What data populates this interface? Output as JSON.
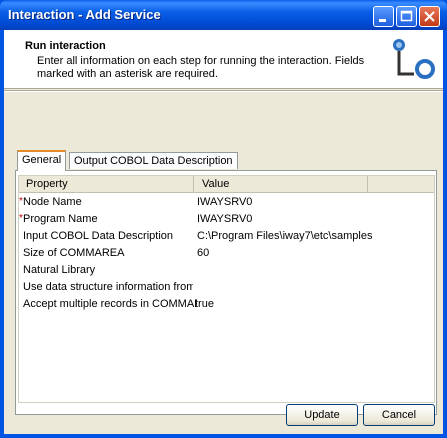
{
  "window": {
    "title": "Interaction - Add Service"
  },
  "header": {
    "title": "Run interaction",
    "description": "Enter all information on each step for running the interaction. Fields marked with an asterisk are required."
  },
  "tabs": [
    {
      "label": "General",
      "active": true
    },
    {
      "label": "Output COBOL Data Description",
      "active": false
    }
  ],
  "table": {
    "columns": [
      "Property",
      "Value"
    ],
    "rows": [
      {
        "property": "Node Name",
        "value": "IWAYSRV0",
        "required": true
      },
      {
        "property": "Program Name",
        "value": "IWAYSRV0",
        "required": true
      },
      {
        "property": "Input COBOL Data Description",
        "value": "C:\\Program Files\\iway7\\etc\\samples",
        "required": false
      },
      {
        "property": "Size of COMMAREA",
        "value": "60",
        "required": false
      },
      {
        "property": "Natural Library",
        "value": "",
        "required": false
      },
      {
        "property": "Use data structure information from",
        "value": "",
        "required": false
      },
      {
        "property": "Accept multiple records in COMMARI",
        "value": "true",
        "required": false
      }
    ],
    "required_marker": "*"
  },
  "buttons": {
    "update": "Update",
    "cancel": "Cancel"
  }
}
